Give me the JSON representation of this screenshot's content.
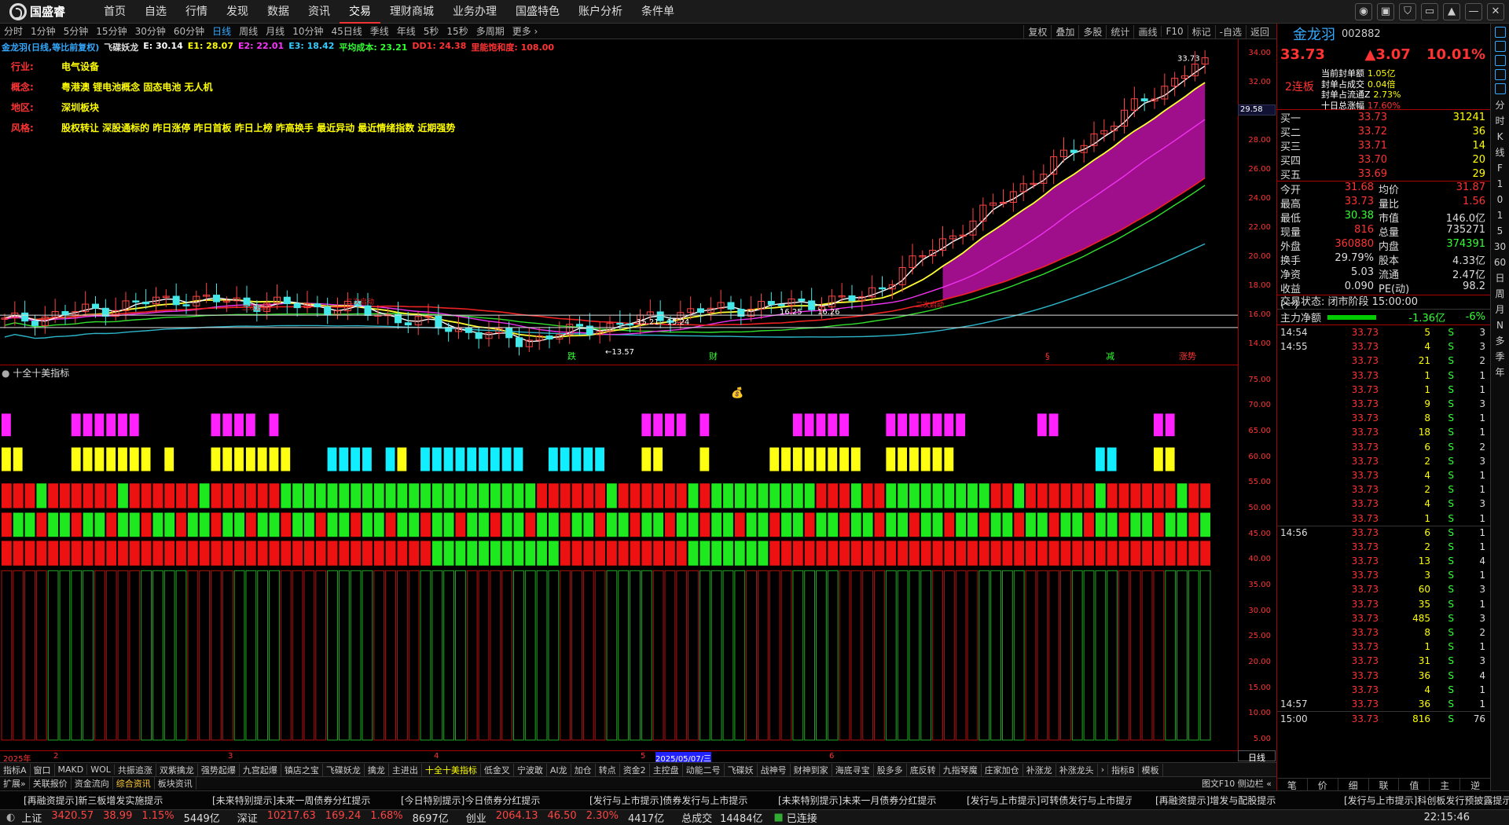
{
  "app": {
    "logo_text": "国盛睿"
  },
  "menu": [
    "首页",
    "自选",
    "行情",
    "发现",
    "数据",
    "资讯",
    "交易",
    "理财商城",
    "业务办理",
    "国盛特色",
    "账户分析",
    "条件单"
  ],
  "menu_active": "交易",
  "window_controls": [
    "◉",
    "▣",
    "⛉",
    "▭",
    "▲",
    "—",
    "✕"
  ],
  "periods": [
    "分时",
    "1分钟",
    "5分钟",
    "15分钟",
    "30分钟",
    "60分钟",
    "日线",
    "周线",
    "月线",
    "10分钟",
    "45日线",
    "季线",
    "年线",
    "5秒",
    "15秒",
    "多周期",
    "更多 ›"
  ],
  "period_active": "日线",
  "tools": [
    "复权",
    "叠加",
    "多股",
    "统计",
    "画线",
    "F10",
    "标记",
    "-自选",
    "返回"
  ],
  "chart_header": {
    "title": "金龙羽(日线,等比前复权)",
    "indicator": "飞碟妖龙",
    "items": [
      {
        "label": "E: 30.14",
        "color": "#ffffff"
      },
      {
        "label": "E1: 28.07",
        "color": "#ffff00"
      },
      {
        "label": "E2: 22.01",
        "color": "#ff33ff"
      },
      {
        "label": "E3: 18.42",
        "color": "#33ccff"
      },
      {
        "label": "平均成本: 23.21",
        "color": "#33ff33"
      },
      {
        "label": "DD1: 24.38",
        "color": "#ff3333"
      },
      {
        "label": "里能饱和度: 108.00",
        "color": "#ff3333"
      }
    ]
  },
  "stock_tags": [
    {
      "key": "行业:",
      "value": "电气设备"
    },
    {
      "key": "概念:",
      "value": "粤港澳 锂电池概念 固态电池 无人机"
    },
    {
      "key": "地区:",
      "value": "深圳板块"
    },
    {
      "key": "风格:",
      "value": "股权转让 深股通标的 昨日涨停 昨日首板 昨日上榜 昨高换手 最近异动 最近情绪指数 近期强势"
    }
  ],
  "main_y_ticks": [
    "34.00",
    "32.00",
    "28.00",
    "26.00",
    "24.00",
    "22.00",
    "20.00",
    "18.00",
    "16.00",
    "14.00"
  ],
  "current_price_flag": "29.58",
  "chart_annotations": {
    "high": "33.73",
    "low": "13.57",
    "range1": "15.21 - 15.24",
    "range2": "16.25",
    "range3": "16.26",
    "marks": [
      "跌",
      "财",
      "§",
      "减",
      "涨势"
    ],
    "shape1": "二次启动",
    "shape2": "二次启动",
    "shape3": "二次启动"
  },
  "indicator_title": "十全十美指标",
  "ind_y_ticks": [
    "75.00",
    "70.00",
    "65.00",
    "60.00",
    "55.00",
    "50.00",
    "45.00",
    "40.00",
    "35.00",
    "30.00",
    "25.00",
    "20.00",
    "15.00",
    "10.00",
    "5.00"
  ],
  "x_labels": [
    "2025年",
    "2",
    "3",
    "4",
    "5",
    "2025/05/07/三",
    "6"
  ],
  "period_label": "日线",
  "chart_data": {
    "type": "candlestick",
    "title": "金龙羽(日线,等比前复权)",
    "ylim": [
      12.6,
      35
    ],
    "last_close": 33.73,
    "high": 33.73,
    "low": 13.57,
    "closes_key_points": [
      {
        "x": "2025年",
        "value": 15.6
      },
      {
        "x": "2",
        "value": 17.2
      },
      {
        "x": "3",
        "value": 16.5
      },
      {
        "x": "4",
        "value": 14.3
      },
      {
        "x": "5",
        "value": 16.3
      },
      {
        "x": "2025/05/07/三",
        "value": 17.2
      },
      {
        "x": "6",
        "value": 25.5
      },
      {
        "x": "end",
        "value": 33.73
      }
    ]
  },
  "ind_tabs": [
    "指标A",
    "窗口",
    "MAKD",
    "WOL",
    "共振追涨",
    "双紫擒龙",
    "强势起爆",
    "九宫起爆",
    "镇店之宝",
    "飞碟妖龙",
    "擒龙",
    "主进出",
    "十全十美指标",
    "低金叉",
    "宁波敢",
    "AI龙",
    "加仓",
    "转点",
    "资金2",
    "主控盘",
    "动能二号",
    "飞碟妖",
    "战神号",
    "财神到家",
    "海底寻宝",
    "股多多",
    "底反转",
    "九指琴魔",
    "庄家加仓",
    "补涨龙",
    "补涨龙头",
    "›",
    "指标B",
    "模板"
  ],
  "ind_tab_active": "十全十美指标",
  "sub_tabs": [
    "扩展»",
    "关联报价",
    "资金流向",
    "综合资讯",
    "板块资讯"
  ],
  "sub_tab_active": "综合资讯",
  "sub_right": "图文F10 侧边栏 «",
  "news": [
    "[再融资提示]新三板增发实施提示",
    "[未来特别提示]未来一周债券分红提示",
    "[今日特别提示]今日债券分红提示",
    "[发行与上市提示]债券发行与上市提示",
    "[未来特别提示]未来一月债券分红提示",
    "[发行与上市提示]可转债发行与上市提示",
    "[再融资提示]增发与配股提示",
    "[发行与上市提示]科创板发行预披露提示"
  ],
  "status": {
    "indices": [
      {
        "name": "上证",
        "value": "3420.57",
        "change": "38.99",
        "pct": "1.15%",
        "amount": "5449亿"
      },
      {
        "name": "深证",
        "value": "10217.63",
        "change": "169.24",
        "pct": "1.68%",
        "amount": "8697亿"
      },
      {
        "name": "创业",
        "value": "2064.13",
        "change": "46.50",
        "pct": "2.30%",
        "amount": "4417亿"
      }
    ],
    "total_label": "总成交",
    "total": "14484亿",
    "connected": "已连接",
    "time": "22:15:46"
  },
  "right": {
    "name": "金龙羽",
    "code": "002882",
    "price": "33.73",
    "change": "▲3.07",
    "pct": "10.01%",
    "lianban": "2连板",
    "seal": [
      {
        "label": "当前封单额",
        "value": "1.05亿"
      },
      {
        "label": "封单占成交",
        "value": "0.04倍"
      },
      {
        "label": "封单占流通Z",
        "value": "2.73%"
      },
      {
        "label": "十日总涨幅",
        "value": "17.60%"
      }
    ],
    "orderbook": [
      {
        "label": "买一",
        "price": "33.73",
        "vol": "31241"
      },
      {
        "label": "买二",
        "price": "33.72",
        "vol": "36"
      },
      {
        "label": "买三",
        "price": "33.71",
        "vol": "14"
      },
      {
        "label": "买四",
        "price": "33.70",
        "vol": "20"
      },
      {
        "label": "买五",
        "price": "33.69",
        "vol": "29"
      }
    ],
    "stats": [
      {
        "l1": "今开",
        "v1": "31.68",
        "c1": "c-red",
        "l2": "均价",
        "v2": "31.87",
        "c2": "c-red"
      },
      {
        "l1": "最高",
        "v1": "33.73",
        "c1": "c-red",
        "l2": "量比",
        "v2": "1.56",
        "c2": "c-red"
      },
      {
        "l1": "最低",
        "v1": "30.38",
        "c1": "c-grn",
        "l2": "市值",
        "v2": "146.0亿",
        "c2": "c-wht"
      },
      {
        "l1": "现量",
        "v1": "816",
        "c1": "c-red",
        "l2": "总量",
        "v2": "735271",
        "c2": "c-wht"
      },
      {
        "l1": "外盘",
        "v1": "360880",
        "c1": "c-red",
        "l2": "内盘",
        "v2": "374391",
        "c2": "c-grn"
      },
      {
        "l1": "换手",
        "v1": "29.79%",
        "c1": "c-wht",
        "l2": "股本",
        "v2": "4.33亿",
        "c2": "c-wht"
      },
      {
        "l1": "净资",
        "v1": "5.03",
        "c1": "c-wht",
        "l2": "流通",
        "v2": "2.47亿",
        "c2": "c-wht"
      },
      {
        "l1": "收益(一)",
        "v1": "0.090",
        "c1": "c-wht",
        "l2": "PE(动)",
        "v2": "98.2",
        "c2": "c-wht"
      }
    ],
    "trade_state": "交易状态: 闭市阶段 15:00:00",
    "capital_label": "主力净额",
    "capital_value": "-1.36亿",
    "capital_pct": "-6%",
    "ticks": [
      {
        "t": "14:54",
        "p": "33.73",
        "v": "5",
        "s": "S",
        "n": "3"
      },
      {
        "t": "14:55",
        "p": "33.73",
        "v": "4",
        "s": "S",
        "n": "3"
      },
      {
        "t": "",
        "p": "33.73",
        "v": "21",
        "s": "S",
        "n": "2"
      },
      {
        "t": "",
        "p": "33.73",
        "v": "1",
        "s": "S",
        "n": "1"
      },
      {
        "t": "",
        "p": "33.73",
        "v": "1",
        "s": "S",
        "n": "1"
      },
      {
        "t": "",
        "p": "33.73",
        "v": "9",
        "s": "S",
        "n": "3"
      },
      {
        "t": "",
        "p": "33.73",
        "v": "8",
        "s": "S",
        "n": "1"
      },
      {
        "t": "",
        "p": "33.73",
        "v": "18",
        "s": "S",
        "n": "1"
      },
      {
        "t": "",
        "p": "33.73",
        "v": "6",
        "s": "S",
        "n": "2"
      },
      {
        "t": "",
        "p": "33.73",
        "v": "2",
        "s": "S",
        "n": "3"
      },
      {
        "t": "",
        "p": "33.73",
        "v": "4",
        "s": "S",
        "n": "1"
      },
      {
        "t": "",
        "p": "33.73",
        "v": "2",
        "s": "S",
        "n": "1"
      },
      {
        "t": "",
        "p": "33.73",
        "v": "4",
        "s": "S",
        "n": "3"
      },
      {
        "t": "",
        "p": "33.73",
        "v": "1",
        "s": "S",
        "n": "1"
      },
      {
        "t": "14:56",
        "p": "33.73",
        "v": "6",
        "s": "S",
        "n": "1"
      },
      {
        "t": "",
        "p": "33.73",
        "v": "2",
        "s": "S",
        "n": "1"
      },
      {
        "t": "",
        "p": "33.73",
        "v": "13",
        "s": "S",
        "n": "4"
      },
      {
        "t": "",
        "p": "33.73",
        "v": "3",
        "s": "S",
        "n": "1"
      },
      {
        "t": "",
        "p": "33.73",
        "v": "60",
        "s": "S",
        "n": "3"
      },
      {
        "t": "",
        "p": "33.73",
        "v": "35",
        "s": "S",
        "n": "1"
      },
      {
        "t": "",
        "p": "33.73",
        "v": "485",
        "s": "S",
        "n": "3"
      },
      {
        "t": "",
        "p": "33.73",
        "v": "8",
        "s": "S",
        "n": "2"
      },
      {
        "t": "",
        "p": "33.73",
        "v": "1",
        "s": "S",
        "n": "1"
      },
      {
        "t": "",
        "p": "33.73",
        "v": "31",
        "s": "S",
        "n": "3"
      },
      {
        "t": "",
        "p": "33.73",
        "v": "36",
        "s": "S",
        "n": "4"
      },
      {
        "t": "",
        "p": "33.73",
        "v": "4",
        "s": "S",
        "n": "1"
      },
      {
        "t": "14:57",
        "p": "33.73",
        "v": "36",
        "s": "S",
        "n": "1"
      },
      {
        "t": "15:00",
        "p": "33.73",
        "v": "816",
        "s": "S",
        "n": "76"
      }
    ],
    "bottom_tabs": [
      "笔",
      "价",
      "细",
      "联",
      "值",
      "主",
      "逆"
    ]
  },
  "side_strip": [
    "分",
    "时",
    "K",
    "线",
    "F",
    "1",
    "0",
    "1",
    "5",
    "30",
    "60",
    "日",
    "周",
    "月",
    "N",
    "多",
    "季",
    "年"
  ]
}
